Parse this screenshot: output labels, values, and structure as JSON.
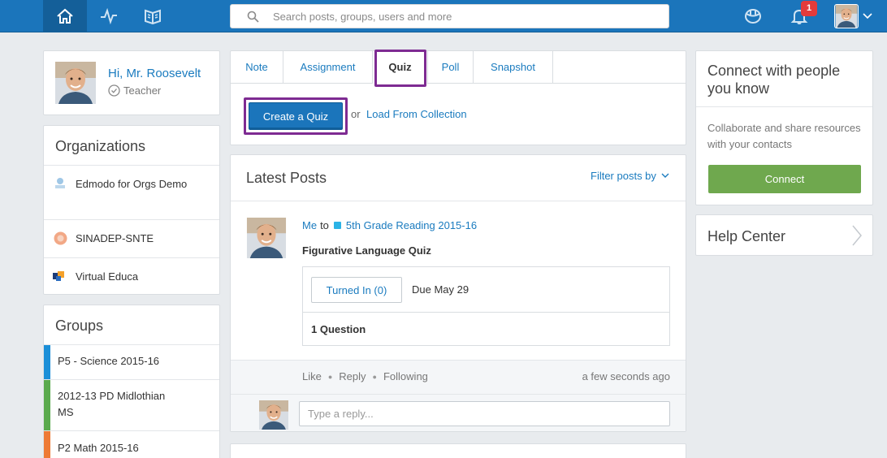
{
  "topbar": {
    "search_placeholder": "Search posts, groups, users and more",
    "notification_count": "1",
    "icons": [
      "home-icon",
      "activity-icon",
      "library-icon",
      "backpack-icon",
      "bell-icon",
      "chevron-down-icon"
    ]
  },
  "profile": {
    "greeting": "Hi, Mr. Roosevelt",
    "role": "Teacher"
  },
  "organizations": {
    "title": "Organizations",
    "items": [
      {
        "label": "Edmodo for Orgs Demo"
      },
      {
        "label": "SINADEP-SNTE"
      },
      {
        "label": "Virtual Educa"
      }
    ]
  },
  "groups": {
    "title": "Groups",
    "items": [
      {
        "label": "P5 - Science 2015-16",
        "color": "#1b8fd8"
      },
      {
        "label": "2012-13 PD Midlothian MS",
        "color": "#5aaa4d"
      },
      {
        "label": "P2 Math 2015-16",
        "color": "#ee7a35"
      }
    ]
  },
  "composer": {
    "tabs": [
      {
        "label": "Note"
      },
      {
        "label": "Assignment"
      },
      {
        "label": "Quiz"
      },
      {
        "label": "Poll"
      },
      {
        "label": "Snapshot"
      }
    ],
    "create_label": "Create a Quiz",
    "or_text": "or",
    "load_label": "Load From Collection"
  },
  "posts": {
    "title": "Latest Posts",
    "filter_label": "Filter posts by",
    "post": {
      "sender": "Me",
      "to_text": "to",
      "group": "5th Grade Reading 2015-16",
      "title": "Figurative Language Quiz",
      "turned_in_label": "Turned In (0)",
      "due": "Due May 29",
      "question_count": "1 Question",
      "actions": [
        "Like",
        "Reply",
        "Following"
      ],
      "time": "a few seconds ago",
      "reply_placeholder": "Type a reply..."
    }
  },
  "connect": {
    "title": "Connect with people you know",
    "text": "Collaborate and share resources with your contacts",
    "button_label": "Connect",
    "button_color": "#6fa84e"
  },
  "help": {
    "title": "Help Center"
  },
  "colors": {
    "brand": "#1b75bb",
    "highlight": "#7e2b92",
    "link": "#1a7bbf"
  }
}
